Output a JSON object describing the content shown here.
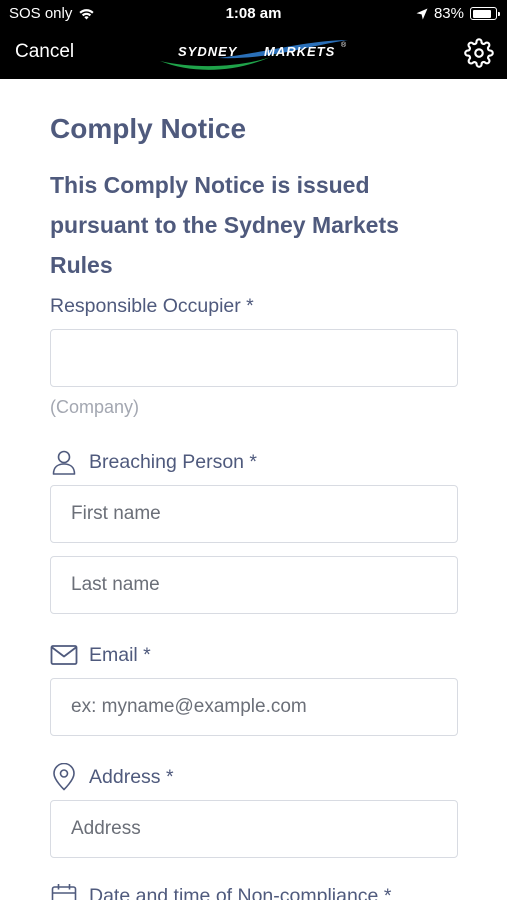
{
  "status_bar": {
    "carrier": "SOS only",
    "time": "1:08 am",
    "battery_percent": "83%",
    "battery_level": 0.83,
    "icons": [
      "wifi-icon",
      "location-arrow-icon",
      "battery-icon"
    ]
  },
  "nav": {
    "cancel_label": "Cancel",
    "logo_text_left": "SYDNEY",
    "logo_text_right": "MARKETS",
    "logo_mark": "®",
    "settings_icon": "gear-icon"
  },
  "form": {
    "title": "Comply Notice",
    "heading": "This Comply Notice is issued pursuant to the Sydney Markets Rules",
    "responsible_occupier": {
      "label": "Responsible Occupier *",
      "value": "",
      "helper": "(Company)"
    },
    "breaching_person": {
      "label": "Breaching Person *",
      "icon": "person-icon",
      "first_name_placeholder": "First name",
      "last_name_placeholder": "Last name"
    },
    "email": {
      "label": "Email *",
      "icon": "envelope-icon",
      "placeholder": "ex: myname@example.com"
    },
    "address": {
      "label": "Address *",
      "icon": "location-pin-icon",
      "placeholder": "Address"
    },
    "datetime": {
      "label": "Date and time of Non-compliance *",
      "icon": "calendar-icon"
    }
  },
  "colors": {
    "accent_text": "#4f5a7d",
    "nav_background": "#000000",
    "logo_swoosh_green": "#1fa34a",
    "logo_swoosh_blue": "#2a6fb8",
    "input_border": "#d8dbe2",
    "helper_text": "#a3a7b1"
  }
}
